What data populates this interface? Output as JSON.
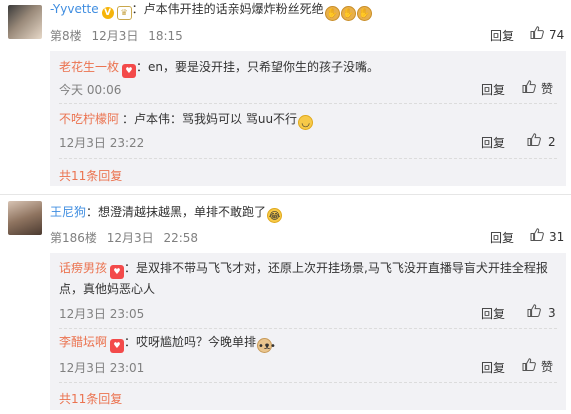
{
  "comments": [
    {
      "user": "-Yyvette",
      "sep": "：",
      "text": "卢本伟开挂的话亲妈爆炸粉丝死绝",
      "emoji_count": 3,
      "floor": "第8楼",
      "date": "12月3日",
      "time": "18:15",
      "reply_label": "回复",
      "like_count": "74",
      "replies": [
        {
          "user": "老花生一枚",
          "sep": "：",
          "text": "en，要是没开挂，只希望你生的孩子没嘴。",
          "date": "今天 00:06",
          "reply_label": "回复",
          "like_label": "赞"
        },
        {
          "user": "不吃柠檬阿",
          "sep": "：",
          "text": "卢本伟：骂我妈可以 骂uu不行",
          "date": "12月3日 23:22",
          "reply_label": "回复",
          "like_label": "2"
        }
      ],
      "more_text": "共11条回复"
    },
    {
      "user": "王尼狗",
      "sep": "：",
      "text": "想澄清越抹越黑，单排不敢跑了",
      "floor": "第186楼",
      "date": "12月3日",
      "time": "22:58",
      "reply_label": "回复",
      "like_count": "31",
      "replies": [
        {
          "user": "话痨男孩",
          "sep": "：",
          "text": "是双排不带马飞飞才对，还原上次开挂场景,马飞飞没开直播导盲犬开挂全程报",
          "text2": "点，真他妈恶心人",
          "date": "12月3日 23:05",
          "reply_label": "回复",
          "like_label": "3"
        },
        {
          "user": "李醋坛啊",
          "sep": "：",
          "text": "哎呀尴尬吗？今晚单排",
          "date": "12月3日 23:01",
          "reply_label": "回复",
          "like_label": "赞"
        }
      ],
      "more_text": "共11条回复"
    }
  ],
  "icons": {
    "verified": "verified-badge-icon",
    "level": "level-badge-icon",
    "like": "thumbs-up-icon"
  },
  "colors": {
    "username": "#eb7350",
    "reply_username": "#3f8de0",
    "reply_background": "#f2f2f5"
  }
}
